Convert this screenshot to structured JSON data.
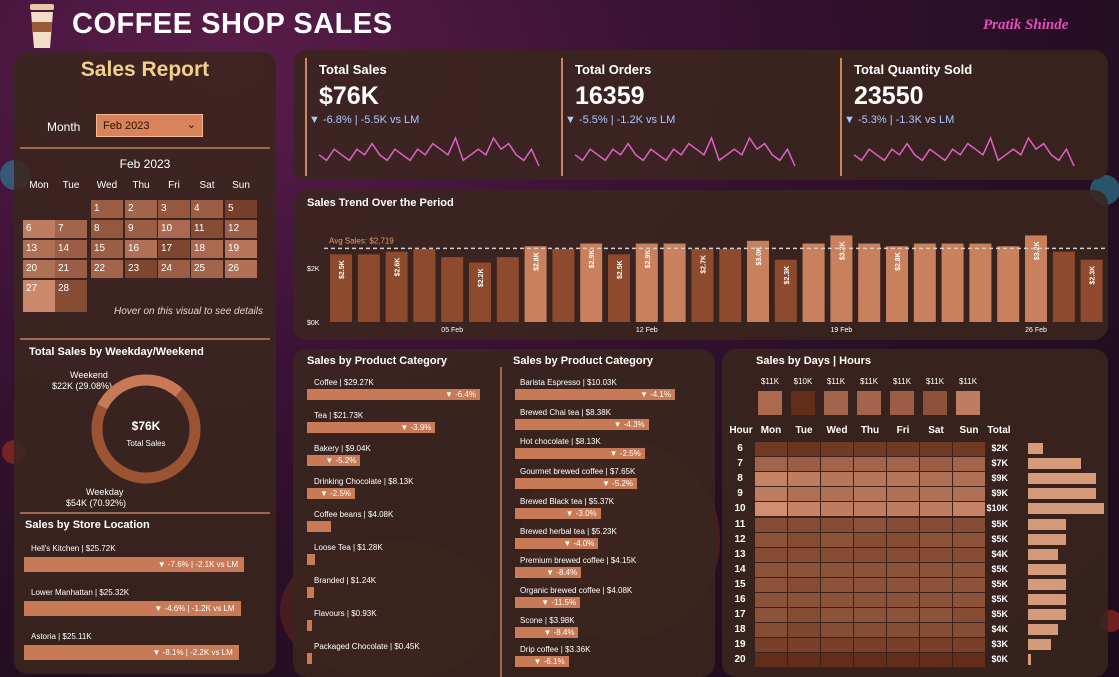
{
  "header": {
    "title": "COFFEE SHOP SALES",
    "author": "Pratik Shinde"
  },
  "sidebar": {
    "title": "Sales Report",
    "month_label": "Month",
    "month_value": "Feb 2023",
    "calendar": {
      "title": "Feb 2023",
      "weekdays": [
        "Mon",
        "Tue",
        "Wed",
        "Thu",
        "Fri",
        "Sat",
        "Sun"
      ],
      "hover_note": "Hover on this visual to see details",
      "days": [
        {
          "d": "1",
          "col": 2,
          "row": 0,
          "shade": 0.45
        },
        {
          "d": "2",
          "col": 3,
          "row": 0,
          "shade": 0.5
        },
        {
          "d": "3",
          "col": 4,
          "row": 0,
          "shade": 0.4
        },
        {
          "d": "4",
          "col": 5,
          "row": 0,
          "shade": 0.45
        },
        {
          "d": "5",
          "col": 6,
          "row": 0,
          "shade": 0.2
        },
        {
          "d": "6",
          "col": 0,
          "row": 1,
          "shade": 0.7
        },
        {
          "d": "7",
          "col": 1,
          "row": 1,
          "shade": 0.5
        },
        {
          "d": "8",
          "col": 2,
          "row": 1,
          "shade": 0.4
        },
        {
          "d": "9",
          "col": 3,
          "row": 1,
          "shade": 0.45
        },
        {
          "d": "10",
          "col": 4,
          "row": 1,
          "shade": 0.55
        },
        {
          "d": "11",
          "col": 5,
          "row": 1,
          "shade": 0.3
        },
        {
          "d": "12",
          "col": 6,
          "row": 1,
          "shade": 0.45
        },
        {
          "d": "13",
          "col": 0,
          "row": 2,
          "shade": 0.6
        },
        {
          "d": "14",
          "col": 1,
          "row": 2,
          "shade": 0.45
        },
        {
          "d": "15",
          "col": 2,
          "row": 2,
          "shade": 0.45
        },
        {
          "d": "16",
          "col": 3,
          "row": 2,
          "shade": 0.6
        },
        {
          "d": "17",
          "col": 4,
          "row": 2,
          "shade": 0.25
        },
        {
          "d": "18",
          "col": 5,
          "row": 2,
          "shade": 0.55
        },
        {
          "d": "19",
          "col": 6,
          "row": 2,
          "shade": 0.65
        },
        {
          "d": "20",
          "col": 0,
          "row": 3,
          "shade": 0.6
        },
        {
          "d": "21",
          "col": 1,
          "row": 3,
          "shade": 0.45
        },
        {
          "d": "22",
          "col": 2,
          "row": 3,
          "shade": 0.5
        },
        {
          "d": "23",
          "col": 3,
          "row": 3,
          "shade": 0.25
        },
        {
          "d": "24",
          "col": 4,
          "row": 3,
          "shade": 0.45
        },
        {
          "d": "25",
          "col": 5,
          "row": 3,
          "shade": 0.5
        },
        {
          "d": "26",
          "col": 6,
          "row": 3,
          "shade": 0.6
        },
        {
          "d": "27",
          "col": 0,
          "row": 4,
          "shade": 0.8
        },
        {
          "d": "28",
          "col": 1,
          "row": 4,
          "shade": 0.3
        }
      ]
    },
    "weekday_weekend": {
      "title": "Total Sales by Weekday/Weekend",
      "weekend_label": "Weekend",
      "weekend_value": "$22K (29.08%)",
      "weekday_label": "Weekday",
      "weekday_value": "$54K (70.92%)",
      "center_value": "$76K",
      "center_label": "Total Sales",
      "weekend_share": 0.2908
    },
    "store": {
      "title": "Sales by Store Location",
      "items": [
        {
          "label": "Hell's Kitchen | $25.72K",
          "delta": "▼ -7.6% | -2.1K vs LM",
          "value": 25.72
        },
        {
          "label": "Lower Manhattan | $25.32K",
          "delta": "▼ -4.6% | -1.2K vs LM",
          "value": 25.32
        },
        {
          "label": "Astoria | $25.11K",
          "delta": "▼ -8.1% | -2.2K vs LM",
          "value": 25.11
        }
      ]
    }
  },
  "kpis": [
    {
      "title": "Total Sales",
      "value": "$76K",
      "delta": "▼ -6.8% | -5.5K vs LM",
      "spark": [
        5,
        4,
        6,
        5,
        4,
        6,
        5,
        7,
        5,
        4,
        6,
        5,
        4,
        6,
        5,
        7,
        6,
        5,
        8,
        4,
        5,
        6,
        5,
        8,
        6,
        7,
        5,
        4,
        6,
        3
      ]
    },
    {
      "title": "Total Orders",
      "value": "16359",
      "delta": "▼ -5.5% | -1.2K vs LM",
      "spark": [
        5,
        4,
        6,
        5,
        4,
        6,
        5,
        7,
        5,
        4,
        6,
        5,
        4,
        6,
        5,
        7,
        6,
        5,
        8,
        4,
        5,
        6,
        5,
        8,
        6,
        7,
        5,
        4,
        6,
        3
      ]
    },
    {
      "title": "Total Quantity Sold",
      "value": "23550",
      "delta": "▼ -5.3% | -1.3K vs LM",
      "spark": [
        5,
        4,
        6,
        5,
        4,
        6,
        5,
        7,
        5,
        4,
        6,
        5,
        4,
        6,
        5,
        7,
        6,
        5,
        8,
        4,
        5,
        6,
        5,
        8,
        6,
        7,
        5,
        4,
        6,
        3
      ]
    }
  ],
  "trend": {
    "title": "Sales Trend Over the Period",
    "avg_label": "Avg Sales: $2,719",
    "ytick_2k": "$2K",
    "ytick_0k": "$0K",
    "xticks": [
      "05 Feb",
      "12 Feb",
      "19 Feb",
      "26 Feb"
    ]
  },
  "chart_data": {
    "type": "bar",
    "title": "Sales Trend Over the Period",
    "categories": [
      "1",
      "2",
      "3",
      "4",
      "5",
      "6",
      "7",
      "8",
      "9",
      "10",
      "11",
      "12",
      "13",
      "14",
      "15",
      "16",
      "17",
      "18",
      "19",
      "20",
      "21",
      "22",
      "23",
      "24",
      "25",
      "26",
      "27",
      "28"
    ],
    "values": [
      2.5,
      2.5,
      2.6,
      2.7,
      2.4,
      2.2,
      2.4,
      2.8,
      2.7,
      2.9,
      2.5,
      2.9,
      2.9,
      2.7,
      2.7,
      3.0,
      2.3,
      2.9,
      3.2,
      2.9,
      2.8,
      2.9,
      2.9,
      2.9,
      2.8,
      3.2,
      2.6,
      2.3
    ],
    "labels": [
      "$2.5K",
      "",
      "$2.6K",
      "",
      "",
      "$2.2K",
      "",
      "$2.8K",
      "",
      "$2.9K",
      "$2.5K",
      "$2.9K",
      "",
      "$2.7K",
      "",
      "$3.0K",
      "$2.3K",
      "",
      "$3.2K",
      "",
      "$2.8K",
      "",
      "",
      "",
      "",
      "$3.2K",
      "",
      "$2.3K"
    ],
    "ylabel": "",
    "ylim": [
      0,
      3.4
    ],
    "avg": 2.719
  },
  "categories_1": {
    "title": "Sales by Product Category",
    "items": [
      {
        "label": "Coffee | $29.27K",
        "delta": "▼ -6.4%",
        "value": 29.27
      },
      {
        "label": "Tea | $21.73K",
        "delta": "▼ -3.9%",
        "value": 21.73
      },
      {
        "label": "Bakery | $9.04K",
        "delta": "▼ -5.2%",
        "value": 9.04
      },
      {
        "label": "Drinking Chocolate | $8.13K",
        "delta": "▼ -2.5%",
        "value": 8.13
      },
      {
        "label": "Coffee beans | $4.08K",
        "delta": "",
        "value": 4.08
      },
      {
        "label": "Loose Tea | $1.28K",
        "delta": "",
        "value": 1.28
      },
      {
        "label": "Branded | $1.24K",
        "delta": "",
        "value": 1.24
      },
      {
        "label": "Flavours | $0.93K",
        "delta": "",
        "value": 0.93
      },
      {
        "label": "Packaged Chocolate | $0.45K",
        "delta": "",
        "value": 0.45
      }
    ]
  },
  "categories_2": {
    "title": "Sales by Product Category",
    "items": [
      {
        "label": "Barista Espresso | $10.03K",
        "delta": "▼ -4.1%",
        "value": 10.03
      },
      {
        "label": "Brewed Chai tea | $8.38K",
        "delta": "▼ -4.3%",
        "value": 8.38
      },
      {
        "label": "Hot chocolate | $8.13K",
        "delta": "▼ -2.5%",
        "value": 8.13
      },
      {
        "label": "Gourmet brewed coffee | $7.65K",
        "delta": "▼ -5.2%",
        "value": 7.65
      },
      {
        "label": "Brewed Black tea | $5.37K",
        "delta": "▼ -3.0%",
        "value": 5.37
      },
      {
        "label": "Brewed herbal tea | $5.23K",
        "delta": "▼ -4.0%",
        "value": 5.23
      },
      {
        "label": "Premium brewed coffee | $4.15K",
        "delta": "▼ -8.4%",
        "value": 4.15
      },
      {
        "label": "Organic brewed coffee | $4.08K",
        "delta": "▼ -11.5%",
        "value": 4.08
      },
      {
        "label": "Scone | $3.98K",
        "delta": "▼ -8.4%",
        "value": 3.98
      },
      {
        "label": "Drip coffee | $3.36K",
        "delta": "▼ -6.1%",
        "value": 3.36
      }
    ]
  },
  "heatmap": {
    "title": "Sales by Days | Hours",
    "hour_label": "Hour",
    "total_label": "Total",
    "days": [
      "Mon",
      "Tue",
      "Wed",
      "Thu",
      "Fri",
      "Sat",
      "Sun"
    ],
    "day_totals": [
      "$11K",
      "$10K",
      "$11K",
      "$11K",
      "$11K",
      "$11K",
      "$11K"
    ],
    "day_shade": [
      0.55,
      0.05,
      0.5,
      0.5,
      0.45,
      0.35,
      0.7
    ],
    "hours": [
      "6",
      "7",
      "8",
      "9",
      "10",
      "11",
      "12",
      "13",
      "14",
      "15",
      "16",
      "17",
      "18",
      "19",
      "20"
    ],
    "hour_totals": [
      "$2K",
      "$7K",
      "$9K",
      "$9K",
      "$10K",
      "$5K",
      "$5K",
      "$4K",
      "$5K",
      "$5K",
      "$5K",
      "$5K",
      "$4K",
      "$3K",
      "$0K"
    ],
    "hour_values": [
      2.0,
      7.0,
      9.0,
      9.0,
      10.0,
      5.0,
      5.0,
      4.0,
      5.0,
      5.0,
      5.0,
      5.0,
      4.0,
      3.0,
      0.4
    ],
    "cells": [
      [
        0.15,
        0.1,
        0.15,
        0.15,
        0.15,
        0.15,
        0.15
      ],
      [
        0.5,
        0.45,
        0.5,
        0.5,
        0.5,
        0.45,
        0.5
      ],
      [
        0.75,
        0.7,
        0.65,
        0.65,
        0.65,
        0.6,
        0.6
      ],
      [
        0.7,
        0.6,
        0.6,
        0.65,
        0.6,
        0.6,
        0.6
      ],
      [
        0.85,
        0.75,
        0.7,
        0.7,
        0.7,
        0.7,
        0.75
      ],
      [
        0.3,
        0.3,
        0.3,
        0.35,
        0.3,
        0.3,
        0.3
      ],
      [
        0.35,
        0.3,
        0.35,
        0.3,
        0.3,
        0.35,
        0.35
      ],
      [
        0.3,
        0.3,
        0.3,
        0.3,
        0.3,
        0.3,
        0.3
      ],
      [
        0.35,
        0.35,
        0.35,
        0.35,
        0.35,
        0.35,
        0.35
      ],
      [
        0.35,
        0.3,
        0.35,
        0.35,
        0.35,
        0.35,
        0.35
      ],
      [
        0.35,
        0.35,
        0.35,
        0.35,
        0.35,
        0.35,
        0.35
      ],
      [
        0.35,
        0.3,
        0.35,
        0.35,
        0.35,
        0.35,
        0.3
      ],
      [
        0.3,
        0.25,
        0.3,
        0.3,
        0.3,
        0.3,
        0.3
      ],
      [
        0.2,
        0.2,
        0.2,
        0.2,
        0.2,
        0.2,
        0.2
      ],
      [
        0.05,
        0.05,
        0.05,
        0.05,
        0.05,
        0.05,
        0.05
      ]
    ]
  },
  "colors": {
    "accent": "#c77a55",
    "panel": "#3a261e",
    "title_gold": "#f0d08a",
    "author": "#e050c0",
    "spark": "#e060c8",
    "delta_blue": "#a8c8ff"
  }
}
